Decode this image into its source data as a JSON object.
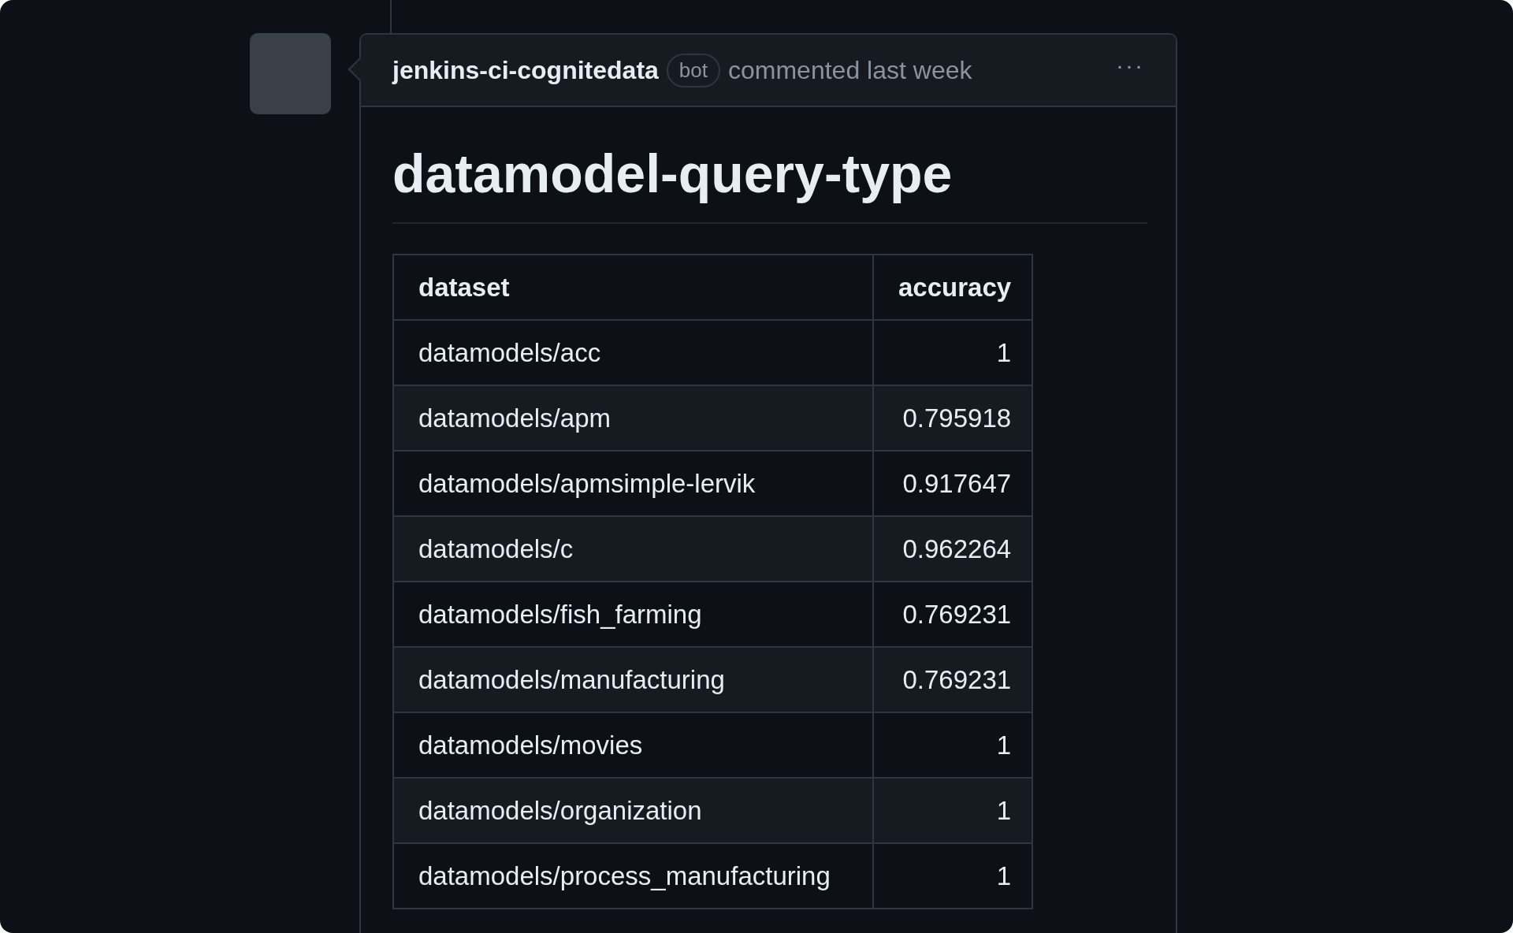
{
  "comment": {
    "author": "jenkins-ci-cognitedata",
    "badge": "bot",
    "action": "commented last week",
    "menu": "···"
  },
  "body": {
    "heading": "datamodel-query-type",
    "table": {
      "columns": [
        "dataset",
        "accuracy"
      ],
      "rows": [
        [
          "datamodels/acc",
          "1"
        ],
        [
          "datamodels/apm",
          "0.795918"
        ],
        [
          "datamodels/apmsimple-lervik",
          "0.917647"
        ],
        [
          "datamodels/c",
          "0.962264"
        ],
        [
          "datamodels/fish_farming",
          "0.769231"
        ],
        [
          "datamodels/manufacturing",
          "0.769231"
        ],
        [
          "datamodels/movies",
          "1"
        ],
        [
          "datamodels/organization",
          "1"
        ],
        [
          "datamodels/process_manufacturing",
          "1"
        ]
      ]
    }
  }
}
